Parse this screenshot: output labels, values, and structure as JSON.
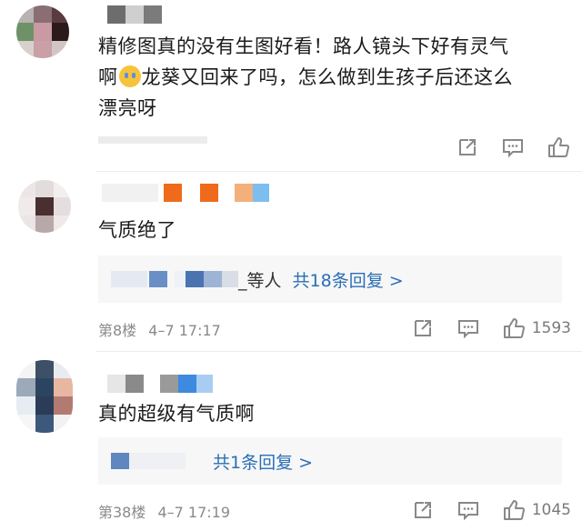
{
  "comments": [
    {
      "content_line1": "精修图真的没有生图好看！路人镜头下好有灵气",
      "content_line2_a": "啊",
      "content_line2_b": "龙葵又回来了吗，怎么做到生孩子后还这么",
      "content_line3": "漂亮呀",
      "emoji": "crying-face-emoji"
    },
    {
      "content": "气质绝了",
      "reply_suffix": "_等人",
      "reply_link": "共18条回复 >",
      "floor": "第8楼",
      "time": "4–7 17:17",
      "likes": "1593"
    },
    {
      "content": "真的超级有气质啊",
      "reply_link": "共1条回复 >",
      "floor": "第38楼",
      "time": "4–7 17:19",
      "likes": "1045"
    }
  ],
  "colors": {
    "link": "#2a6fb6",
    "meta": "#8a8a8a",
    "reply_bg": "#f7f7f7"
  }
}
